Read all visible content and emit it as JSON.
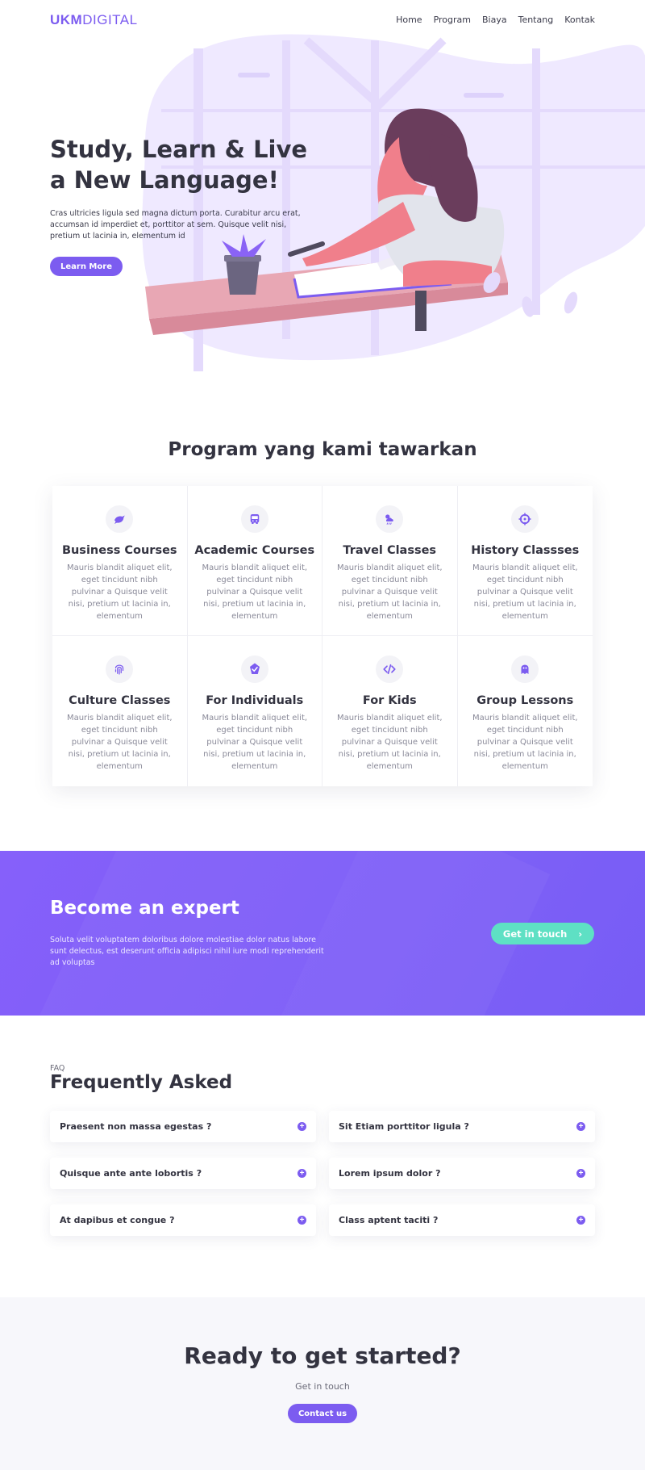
{
  "nav": {
    "logo_bold": "UKM",
    "logo_light": "DIGITAL",
    "links": [
      "Home",
      "Program",
      "Biaya",
      "Tentang",
      "Kontak"
    ]
  },
  "hero": {
    "title": "Study, Learn & Live a New Language!",
    "description": "Cras ultricies ligula sed magna dictum porta. Curabitur arcu erat, accumsan id imperdiet et, porttitor at sem. Quisque velit nisi, pretium ut lacinia in, elementum id",
    "button_label": "Learn More"
  },
  "programs": {
    "title": "Program yang kami tawarkan",
    "items": [
      {
        "title": "Business Courses",
        "icon": "dove-icon",
        "desc": "Mauris blandit aliquet elit, eget tincidunt nibh pulvinar a Quisque velit nisi, pretium ut lacinia in, elementum"
      },
      {
        "title": "Academic Courses",
        "icon": "bus-icon",
        "desc": "Mauris blandit aliquet elit, eget tincidunt nibh pulvinar a Quisque velit nisi, pretium ut lacinia in, elementum"
      },
      {
        "title": "Travel Classes",
        "icon": "weather-icon",
        "desc": "Mauris blandit aliquet elit, eget tincidunt nibh pulvinar a Quisque velit nisi, pretium ut lacinia in, elementum"
      },
      {
        "title": "History Classses",
        "icon": "crosshair-icon",
        "desc": "Mauris blandit aliquet elit, eget tincidunt nibh pulvinar a Quisque velit nisi, pretium ut lacinia in, elementum"
      },
      {
        "title": "Culture Classes",
        "icon": "fingerprint-icon",
        "desc": "Mauris blandit aliquet elit, eget tincidunt nibh pulvinar a Quisque velit nisi, pretium ut lacinia in, elementum"
      },
      {
        "title": "For Individuals",
        "icon": "check-badge-icon",
        "desc": "Mauris blandit aliquet elit, eget tincidunt nibh pulvinar a Quisque velit nisi, pretium ut lacinia in, elementum"
      },
      {
        "title": "For Kids",
        "icon": "code-icon",
        "desc": "Mauris blandit aliquet elit, eget tincidunt nibh pulvinar a Quisque velit nisi, pretium ut lacinia in, elementum"
      },
      {
        "title": "Group Lessons",
        "icon": "ghost-icon",
        "desc": "Mauris blandit aliquet elit, eget tincidunt nibh pulvinar a Quisque velit nisi, pretium ut lacinia in, elementum"
      }
    ]
  },
  "expert": {
    "title": "Become an expert",
    "description": "Soluta velit voluptatem doloribus dolore molestiae dolor natus labore sunt delectus, est deserunt officia adipisci nihil iure modi reprehenderit ad voluptas",
    "button_label": "Get in touch",
    "button_arrow": "›"
  },
  "faq": {
    "label": "FAQ",
    "title": "Frequently Asked",
    "items": [
      "Praesent non massa egestas ?",
      "Sit Etiam porttitor ligula ?",
      "Quisque ante ante lobortis ?",
      "Lorem ipsum dolor  ?",
      "At dapibus et congue ?",
      "Class aptent taciti ?"
    ],
    "plus": "+"
  },
  "cta": {
    "title": "Ready to get started?",
    "subtitle": "Get in touch",
    "button_label": "Contact us"
  },
  "colors": {
    "accent": "#7c5cf0",
    "teal": "#5ee0c4",
    "dark_text": "#333340",
    "muted_text": "#8a8a99",
    "banner": "#7b5cf7",
    "hero_blob": "#efe9ff"
  }
}
